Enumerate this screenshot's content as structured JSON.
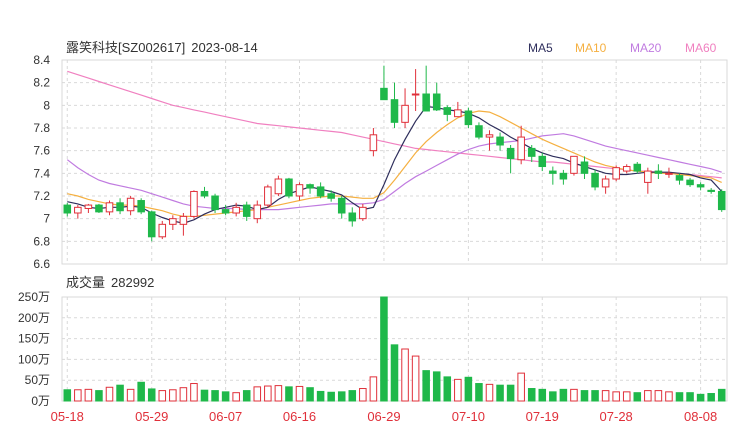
{
  "header": {
    "stock": "露笑科技[SZ002617]",
    "date": "2023-08-14"
  },
  "ma_legend": [
    {
      "label": "MA5",
      "color": "#2e2e5c"
    },
    {
      "label": "MA10",
      "color": "#f5b041"
    },
    {
      "label": "MA20",
      "color": "#c07be0"
    },
    {
      "label": "MA60",
      "color": "#f080c0"
    }
  ],
  "volume_header": {
    "label": "成交量",
    "value": "282992"
  },
  "colors": {
    "up": "#e0303a",
    "down": "#1fb84a",
    "grid": "#d9d9d9",
    "axis_text": "#333333",
    "date_text": "#e0303a"
  },
  "chart_data": [
    {
      "type": "candlestick",
      "price_axis": {
        "ticks": [
          "8.4",
          "8.2",
          "8",
          "7.8",
          "7.6",
          "7.4",
          "7.2",
          "7",
          "6.8",
          "6.6"
        ],
        "ylim": [
          6.6,
          8.4
        ]
      },
      "dates": [
        "05-18",
        "05-29",
        "06-07",
        "06-16",
        "06-29",
        "07-10",
        "07-19",
        "07-28",
        "08-08"
      ],
      "candles": [
        [
          7.12,
          7.14,
          7.02,
          7.05
        ],
        [
          7.05,
          7.12,
          7.0,
          7.1
        ],
        [
          7.09,
          7.13,
          7.05,
          7.12
        ],
        [
          7.12,
          7.13,
          7.05,
          7.06
        ],
        [
          7.06,
          7.16,
          7.03,
          7.14
        ],
        [
          7.14,
          7.18,
          7.04,
          7.07
        ],
        [
          7.07,
          7.2,
          7.03,
          7.18
        ],
        [
          7.16,
          7.18,
          7.04,
          7.06
        ],
        [
          7.06,
          7.07,
          6.8,
          6.84
        ],
        [
          6.84,
          6.98,
          6.82,
          6.95
        ],
        [
          6.95,
          7.03,
          6.9,
          7.0
        ],
        [
          6.95,
          7.05,
          6.85,
          7.02
        ],
        [
          7.02,
          7.25,
          7.0,
          7.24
        ],
        [
          7.24,
          7.28,
          7.18,
          7.2
        ],
        [
          7.2,
          7.22,
          7.05,
          7.08
        ],
        [
          7.08,
          7.12,
          7.03,
          7.05
        ],
        [
          7.05,
          7.14,
          7.02,
          7.1
        ],
        [
          7.12,
          7.15,
          6.98,
          7.02
        ],
        [
          7.0,
          7.16,
          6.96,
          7.12
        ],
        [
          7.12,
          7.3,
          7.1,
          7.28
        ],
        [
          7.22,
          7.38,
          7.2,
          7.35
        ],
        [
          7.35,
          7.36,
          7.18,
          7.2
        ],
        [
          7.2,
          7.32,
          7.16,
          7.3
        ],
        [
          7.3,
          7.31,
          7.22,
          7.27
        ],
        [
          7.28,
          7.32,
          7.18,
          7.2
        ],
        [
          7.22,
          7.25,
          7.15,
          7.18
        ],
        [
          7.18,
          7.2,
          7.0,
          7.05
        ],
        [
          7.05,
          7.1,
          6.93,
          6.98
        ],
        [
          7.0,
          7.13,
          6.98,
          7.1
        ],
        [
          7.6,
          7.8,
          7.55,
          7.74
        ],
        [
          8.15,
          8.35,
          8.05,
          8.05
        ],
        [
          8.05,
          8.2,
          7.8,
          7.85
        ],
        [
          7.85,
          8.15,
          7.8,
          8.0
        ],
        [
          8.1,
          8.32,
          7.95,
          8.1
        ],
        [
          8.1,
          8.35,
          7.95,
          7.95
        ],
        [
          8.1,
          8.2,
          7.95,
          7.96
        ],
        [
          7.98,
          8.0,
          7.86,
          7.92
        ],
        [
          7.9,
          8.03,
          7.9,
          7.96
        ],
        [
          7.95,
          7.98,
          7.8,
          7.83
        ],
        [
          7.82,
          7.85,
          7.7,
          7.72
        ],
        [
          7.72,
          7.78,
          7.6,
          7.74
        ],
        [
          7.72,
          7.76,
          7.6,
          7.65
        ],
        [
          7.62,
          7.65,
          7.4,
          7.53
        ],
        [
          7.52,
          7.82,
          7.48,
          7.72
        ],
        [
          7.62,
          7.65,
          7.5,
          7.55
        ],
        [
          7.55,
          7.58,
          7.42,
          7.46
        ],
        [
          7.42,
          7.46,
          7.3,
          7.4
        ],
        [
          7.4,
          7.43,
          7.3,
          7.35
        ],
        [
          7.4,
          7.55,
          7.38,
          7.55
        ],
        [
          7.5,
          7.55,
          7.35,
          7.4
        ],
        [
          7.4,
          7.43,
          7.25,
          7.28
        ],
        [
          7.28,
          7.38,
          7.22,
          7.35
        ],
        [
          7.35,
          7.47,
          7.33,
          7.45
        ],
        [
          7.42,
          7.48,
          7.4,
          7.46
        ],
        [
          7.48,
          7.5,
          7.4,
          7.42
        ],
        [
          7.32,
          7.45,
          7.22,
          7.42
        ],
        [
          7.42,
          7.48,
          7.35,
          7.4
        ],
        [
          7.4,
          7.45,
          7.36,
          7.4
        ],
        [
          7.38,
          7.4,
          7.3,
          7.34
        ],
        [
          7.34,
          7.36,
          7.28,
          7.3
        ],
        [
          7.3,
          7.32,
          7.25,
          7.28
        ],
        [
          7.25,
          7.27,
          7.22,
          7.24
        ],
        [
          7.24,
          7.26,
          7.06,
          7.08
        ]
      ],
      "ma5": [
        7.15,
        7.13,
        7.1,
        7.09,
        7.1,
        7.1,
        7.11,
        7.1,
        7.05,
        7.01,
        6.98,
        6.96,
        6.99,
        7.04,
        7.08,
        7.1,
        7.12,
        7.11,
        7.08,
        7.1,
        7.17,
        7.22,
        7.25,
        7.28,
        7.26,
        7.24,
        7.21,
        7.14,
        7.08,
        7.1,
        7.3,
        7.52,
        7.7,
        7.86,
        7.99,
        7.98,
        7.96,
        7.95,
        7.93,
        7.89,
        7.83,
        7.78,
        7.72,
        7.67,
        7.62,
        7.58,
        7.55,
        7.53,
        7.49,
        7.46,
        7.43,
        7.4,
        7.39,
        7.39,
        7.4,
        7.41,
        7.41,
        7.41,
        7.4,
        7.39,
        7.36,
        7.34,
        7.24
      ],
      "ma10": [
        7.22,
        7.2,
        7.17,
        7.15,
        7.13,
        7.12,
        7.12,
        7.11,
        7.09,
        7.07,
        7.04,
        7.02,
        7.02,
        7.03,
        7.04,
        7.05,
        7.06,
        7.07,
        7.08,
        7.1,
        7.12,
        7.14,
        7.16,
        7.18,
        7.19,
        7.2,
        7.2,
        7.19,
        7.18,
        7.18,
        7.23,
        7.34,
        7.46,
        7.58,
        7.68,
        7.76,
        7.83,
        7.89,
        7.93,
        7.95,
        7.94,
        7.9,
        7.85,
        7.8,
        7.75,
        7.7,
        7.66,
        7.62,
        7.58,
        7.54,
        7.5,
        7.47,
        7.45,
        7.43,
        7.42,
        7.41,
        7.4,
        7.4,
        7.39,
        7.38,
        7.37,
        7.36,
        7.32
      ],
      "ma20": [
        7.52,
        7.45,
        7.39,
        7.34,
        7.31,
        7.29,
        7.27,
        7.25,
        7.22,
        7.19,
        7.16,
        7.13,
        7.11,
        7.1,
        7.09,
        7.09,
        7.09,
        7.08,
        7.08,
        7.08,
        7.08,
        7.09,
        7.1,
        7.11,
        7.12,
        7.13,
        7.13,
        7.13,
        7.13,
        7.14,
        7.17,
        7.24,
        7.31,
        7.37,
        7.42,
        7.47,
        7.52,
        7.57,
        7.61,
        7.64,
        7.66,
        7.67,
        7.68,
        7.69,
        7.71,
        7.73,
        7.74,
        7.75,
        7.73,
        7.7,
        7.67,
        7.64,
        7.62,
        7.6,
        7.58,
        7.56,
        7.54,
        7.52,
        7.5,
        7.48,
        7.46,
        7.44,
        7.41
      ],
      "ma60": [
        8.3,
        8.27,
        8.24,
        8.21,
        8.18,
        8.15,
        8.12,
        8.09,
        8.06,
        8.03,
        8.0,
        7.98,
        7.96,
        7.94,
        7.92,
        7.9,
        7.88,
        7.86,
        7.84,
        7.83,
        7.82,
        7.81,
        7.8,
        7.79,
        7.78,
        7.77,
        7.76,
        7.74,
        7.72,
        7.7,
        7.68,
        7.66,
        7.64,
        7.62,
        7.61,
        7.6,
        7.59,
        7.58,
        7.57,
        7.56,
        7.55,
        7.54,
        7.53,
        7.52,
        7.51,
        7.5,
        7.5,
        7.49,
        7.48,
        7.47,
        7.46,
        7.45,
        7.44,
        7.43,
        7.42,
        7.42,
        7.41,
        7.4,
        7.4,
        7.39,
        7.38,
        7.37,
        7.36
      ]
    },
    {
      "type": "bar",
      "volume_axis": {
        "ticks": [
          "250万",
          "200万",
          "150万",
          "100万",
          "50万",
          "0万"
        ],
        "ylim": [
          0,
          250
        ]
      },
      "values": [
        27,
        27,
        28,
        25,
        33,
        38,
        28,
        45,
        29,
        25,
        27,
        32,
        42,
        26,
        25,
        22,
        20,
        25,
        34,
        36,
        37,
        34,
        35,
        32,
        23,
        21,
        22,
        25,
        30,
        58,
        250,
        135,
        125,
        108,
        73,
        70,
        58,
        52,
        57,
        42,
        40,
        38,
        38,
        67,
        30,
        28,
        22,
        28,
        28,
        25,
        25,
        25,
        22,
        22,
        20,
        25,
        25,
        22,
        20,
        20,
        16,
        18,
        28
      ],
      "up_down": [
        "d",
        "u",
        "u",
        "d",
        "u",
        "d",
        "u",
        "d",
        "d",
        "u",
        "u",
        "u",
        "u",
        "d",
        "d",
        "d",
        "u",
        "d",
        "u",
        "u",
        "u",
        "d",
        "u",
        "d",
        "d",
        "d",
        "d",
        "d",
        "u",
        "u",
        "d",
        "d",
        "u",
        "u",
        "d",
        "d",
        "d",
        "u",
        "d",
        "d",
        "u",
        "d",
        "d",
        "u",
        "d",
        "d",
        "d",
        "d",
        "u",
        "d",
        "d",
        "u",
        "u",
        "u",
        "d",
        "u",
        "u",
        "u",
        "d",
        "d",
        "d",
        "d",
        "d"
      ]
    }
  ]
}
